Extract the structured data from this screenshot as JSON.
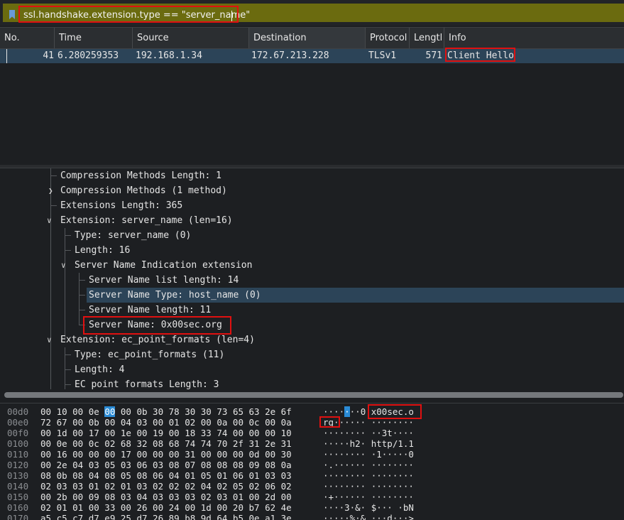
{
  "filter": {
    "text": "ssl.handshake.extension.type == \"server_name\""
  },
  "packet_list": {
    "columns": [
      "No.",
      "Time",
      "Source",
      "Destination",
      "Protocol",
      "Lengtl",
      "Info"
    ],
    "sorted_column": "Destination",
    "rows": [
      {
        "no": "41",
        "time": "6.280259353",
        "source": "192.168.1.34",
        "destination": "172.67.213.228",
        "protocol": "TLSv1",
        "length": "571",
        "info": "Client Hello"
      }
    ]
  },
  "details": {
    "lines": [
      "Compression Methods Length: 1",
      "Compression Methods (1 method)",
      "Extensions Length: 365",
      "Extension: server_name (len=16)",
      "Type: server_name (0)",
      "Length: 16",
      "Server Name Indication extension",
      "Server Name list length: 14",
      "Server Name Type: host_name (0)",
      "Server Name length: 11",
      "Server Name: 0x00sec.org",
      "Extension: ec_point_formats (len=4)",
      "Type: ec_point_formats (11)",
      "Length: 4",
      "EC point formats Length: 3"
    ],
    "selected": "Server Name Type: host_name (0)",
    "highlighted": "Server Name: 0x00sec.org"
  },
  "bytes": {
    "rows": [
      {
        "offset": "00d0",
        "hex_a": "00 10 00 0e ",
        "hex_sel": "00",
        "hex_b": " 00 0b 30  78 30 30 73 65 63 2e 6f",
        "ascii_a": "····",
        "ascii_sel": "·",
        "ascii_b": "··0 x00sec.o"
      },
      {
        "offset": "00e0",
        "hex": "72 67 00 0b 00 04 03 00  01 02 00 0a 00 0c 00 0a",
        "ascii": "rg······ ········"
      },
      {
        "offset": "00f0",
        "hex": "00 1d 00 17 00 1e 00 19  00 18 33 74 00 00 00 10",
        "ascii": "········ ··3t····"
      },
      {
        "offset": "0100",
        "hex": "00 0e 00 0c 02 68 32 08  68 74 74 70 2f 31 2e 31",
        "ascii": "·····h2· http/1.1"
      },
      {
        "offset": "0110",
        "hex": "00 16 00 00 00 17 00 00  00 31 00 00 00 0d 00 30",
        "ascii": "········ ·1·····0"
      },
      {
        "offset": "0120",
        "hex": "00 2e 04 03 05 03 06 03  08 07 08 08 08 09 08 0a",
        "ascii": "·.······ ········"
      },
      {
        "offset": "0130",
        "hex": "08 0b 08 04 08 05 08 06  04 01 05 01 06 01 03 03",
        "ascii": "········ ········"
      },
      {
        "offset": "0140",
        "hex": "02 03 03 01 02 01 03 02  02 02 04 02 05 02 06 02",
        "ascii": "········ ········"
      },
      {
        "offset": "0150",
        "hex": "00 2b 00 09 08 03 04 03  03 03 02 03 01 00 2d 00",
        "ascii": "·+······ ········"
      },
      {
        "offset": "0160",
        "hex": "02 01 01 00 33 00 26 00  24 00 1d 00 20 b7 62 4e",
        "ascii": "····3·&· $··· ·bN"
      },
      {
        "offset": "0170",
        "hex": "a5 c5 c7 d7 e9 25 d7 26  89 b8 9d 64 b5 0e a1 3e",
        "ascii": "·····%·& ···d···>"
      }
    ]
  },
  "colors": {
    "highlight_box": "#e01010",
    "selection": "#2c4458",
    "filter_bg": "#6b6b0f",
    "byte_select": "#2a8bd6"
  }
}
